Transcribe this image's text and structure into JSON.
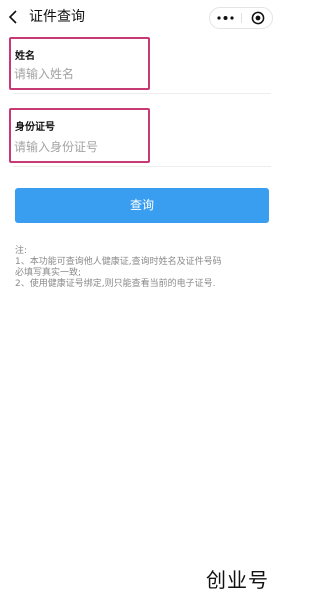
{
  "header": {
    "title": "证件查询",
    "back_icon": "chevron-left-icon",
    "more_icon": "more-dots-icon",
    "close_icon": "target-circle-icon"
  },
  "form": {
    "name_label": "姓名",
    "name_placeholder": "请输入姓名",
    "id_label": "身份证号",
    "id_placeholder": "请输入身份证号",
    "highlight_color": "#c73a74"
  },
  "query_button": {
    "label": "查询",
    "color": "#3a9ef0"
  },
  "notes": {
    "heading": "注:",
    "line1": "1、本功能可查询他人健康证,查询时姓名及证件号码",
    "line2": "必填写真实一致;",
    "line3": "2、使用健康证号绑定,则只能查看当前的电子证号."
  },
  "watermark": "创业号"
}
